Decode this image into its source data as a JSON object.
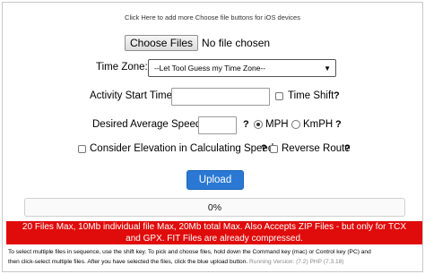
{
  "header": {
    "ios_link": "Click Here to add more Choose file buttons for iOS devices"
  },
  "file_input": {
    "button_label": "Choose Files",
    "status": "No file chosen"
  },
  "time_zone": {
    "label": "Time Zone:",
    "selected": "--Let Tool Guess my Time Zone--",
    "caret": "▼"
  },
  "activity_start": {
    "label": "Activity Start Time:",
    "value": "",
    "time_shift_label": "Time Shift",
    "time_shift_checked": false,
    "help": "?"
  },
  "average_speed": {
    "label": "Desired Average Speed:",
    "value": "",
    "help": "?",
    "unit_options": [
      {
        "label": "MPH",
        "checked": true
      },
      {
        "label": "KmPH",
        "checked": false
      }
    ],
    "unit_help": "?"
  },
  "elevation": {
    "label": "Consider Elevation in Calculating Speed",
    "checked": false,
    "help": "?"
  },
  "reverse_route": {
    "label": "Reverse Route",
    "checked": false,
    "help": "?"
  },
  "upload": {
    "label": "Upload"
  },
  "progress": {
    "label": "0%",
    "value": 0
  },
  "limits_banner": {
    "line1": "20 Files Max, 10Mb individual file Max, 20Mb total Max. Also Accepts ZIP Files - but only for TCX",
    "line2": "and GPX. FIT Files are already compressed."
  },
  "instructions": {
    "line1": "To select multiple files in sequence, use the shift key. To pick and choose files, hold down the Command key (mac) or Control key (PC) and",
    "line2": "then click-select multiple files. After you have selected the files, click the blue upload button.",
    "version": "Running Version: (7.2) PHP (7.3.18)"
  },
  "colors": {
    "accent": "#2a78d4",
    "banner": "#e00b0b"
  }
}
